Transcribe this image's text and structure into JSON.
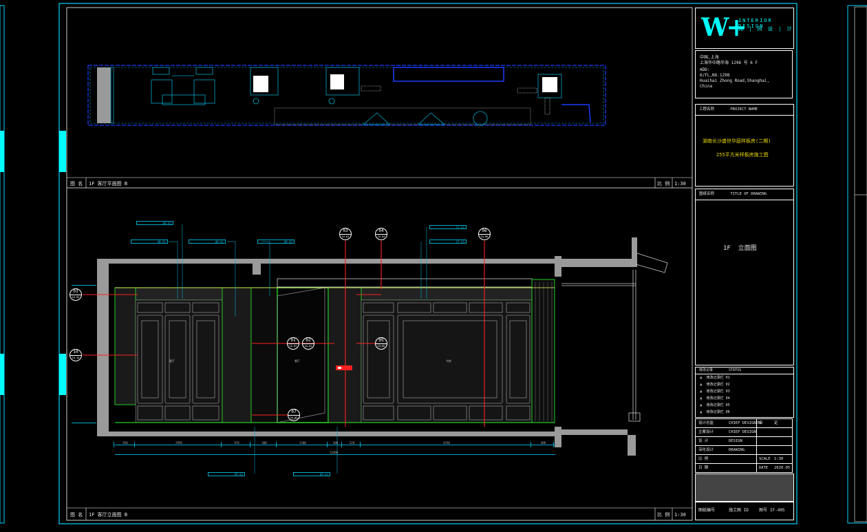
{
  "brand": {
    "logo_letters": "W+",
    "name": "INTERIOR DESIGN",
    "name_cn": "允 | 同 设 | 计"
  },
  "title_block": {
    "address_label": "中国,上海",
    "address_cn": "上海华中路华海 1296 号 6 F",
    "address_en_1": "ADD:",
    "address_en_2": "6/FL,NO.1298",
    "address_en_3": "Huaihai Zhong Road,Shanghai,",
    "address_en_4": "China",
    "project_label": "工程名称",
    "project_label_en": "PROJECT NAME",
    "project_line1": "湖南长沙盛世华庭样板房(二期)",
    "project_line2": "255平方米样板房施工图",
    "drawing_label": "图纸名称",
    "drawing_label_en": "TITLE OF DRAWING",
    "drawing_title": "1F  立面图",
    "revision_label": "修改记录",
    "revision_label_en": "STATUS",
    "revisions": [
      "修改记录栏 01",
      "修改记录栏 02",
      "修改记录栏 03",
      "修改记录栏 04",
      "修改记录栏 05",
      "修改记录栏 06"
    ],
    "rows": [
      {
        "label": "设计总监",
        "value": "CHIEF DESIGNER",
        "label2": "审",
        "value2": "定"
      },
      {
        "label": "主案设计",
        "value": "CHIEF DESIGN",
        "label2": "",
        "value2": ""
      },
      {
        "label": "设 计",
        "value": "DESIGN",
        "label2": "",
        "value2": ""
      },
      {
        "label": "深化设计",
        "value": "DRAWING",
        "label2": "",
        "value2": ""
      },
      {
        "label": "比 例",
        "value": "",
        "label2": "SCALE",
        "value2": "1:30"
      },
      {
        "label": "日 期",
        "value": "",
        "label2": "DATE",
        "value2": "2020.05"
      }
    ],
    "stamp_label": "图纸编号",
    "stamp_value": "施工图 ID",
    "sheet_label": "图号",
    "sheet_no": "IF-405"
  },
  "views": [
    {
      "label": "图 名",
      "title": "1F 客厅平面图 B",
      "scale_label": "比 例",
      "scale": "1:30"
    },
    {
      "label": "图 名",
      "title": "1F 客厅立面图 B",
      "scale_label": "比 例",
      "scale": "1:30"
    }
  ],
  "callouts": [
    "03",
    "04",
    "06",
    "01",
    "02",
    "05",
    "10",
    "07",
    "03"
  ],
  "callout_subs": [
    "IA-03",
    "IA-04",
    "IA-06",
    "IA-01",
    "IA-02",
    "IA-05",
    "IA-10",
    "IA-07",
    "IA-03"
  ],
  "material_tags": [
    "WD-01",
    "WD-01",
    "WD-01",
    "WD-03",
    "ST-01",
    "ST-05",
    "MT-01",
    "WP-01"
  ],
  "room_labels": [
    "客厅",
    "餐厅",
    "书房"
  ],
  "dimensions": [
    "450",
    "2950",
    "970",
    "380",
    "1100",
    "200",
    "220",
    "4250",
    "480",
    "12460"
  ],
  "colors": {
    "frame": "#00d6ff",
    "accent": "#00ffff",
    "wall": "#9a9a9a",
    "green": "#22cc22",
    "red": "#ff2020",
    "blue": "#1a3cff",
    "text": "#e8e8e8"
  }
}
